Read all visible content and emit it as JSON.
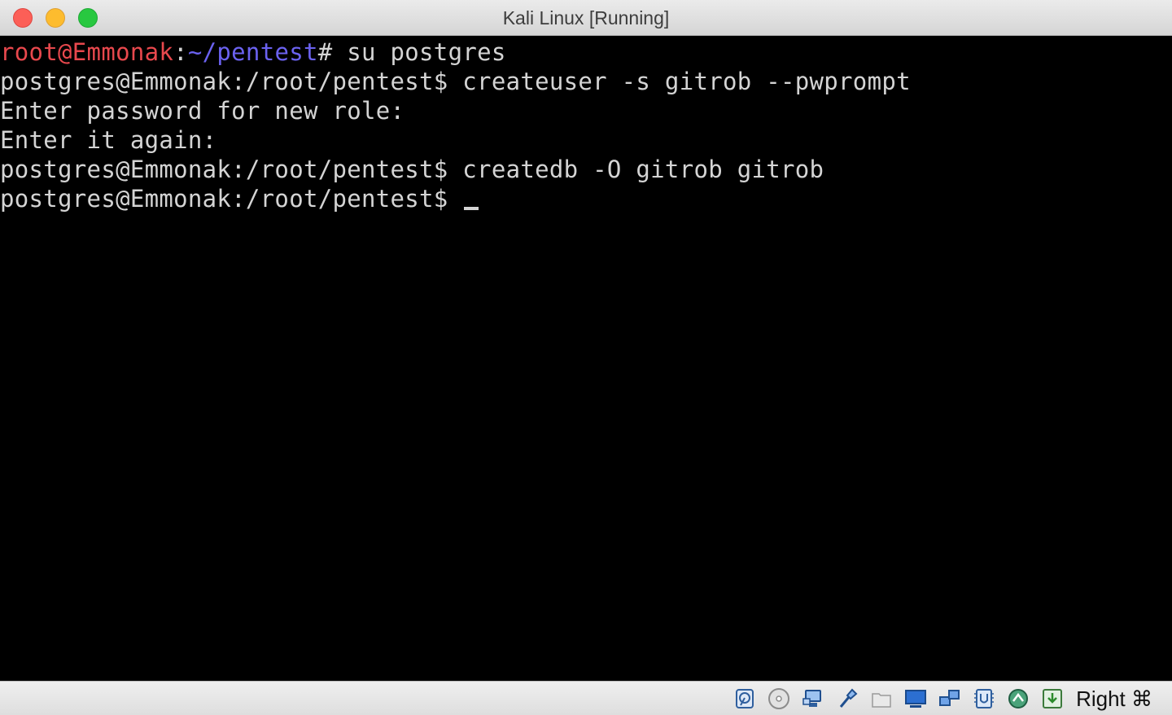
{
  "window": {
    "title": "Kali Linux [Running]"
  },
  "terminal": {
    "lines": [
      [
        {
          "text": "root@Emmonak",
          "color": "red"
        },
        {
          "text": ":",
          "color": "default"
        },
        {
          "text": "~/pentest",
          "color": "blue"
        },
        {
          "text": "# su postgres",
          "color": "default"
        }
      ],
      [
        {
          "text": "postgres@Emmonak:/root/pentest$ createuser -s gitrob --pwprompt",
          "color": "default"
        }
      ],
      [
        {
          "text": "Enter password for new role:",
          "color": "default"
        }
      ],
      [
        {
          "text": "Enter it again:",
          "color": "default"
        }
      ],
      [
        {
          "text": "postgres@Emmonak:/root/pentest$ createdb -O gitrob gitrob",
          "color": "default"
        }
      ],
      [
        {
          "text": "postgres@Emmonak:/root/pentest$ ",
          "color": "default"
        }
      ]
    ],
    "colors": {
      "red": "#e8484d",
      "blue": "#6b62f0",
      "default": "#d4d4d4"
    }
  },
  "statusbar": {
    "icons": [
      "hard-disk-icon",
      "optical-drive-icon",
      "audio-icon",
      "usb-icon",
      "shared-folders-icon",
      "display-icon",
      "network-icon",
      "cpu-icon",
      "capture-icon",
      "download-icon"
    ],
    "host_key": "Right ⌘"
  }
}
